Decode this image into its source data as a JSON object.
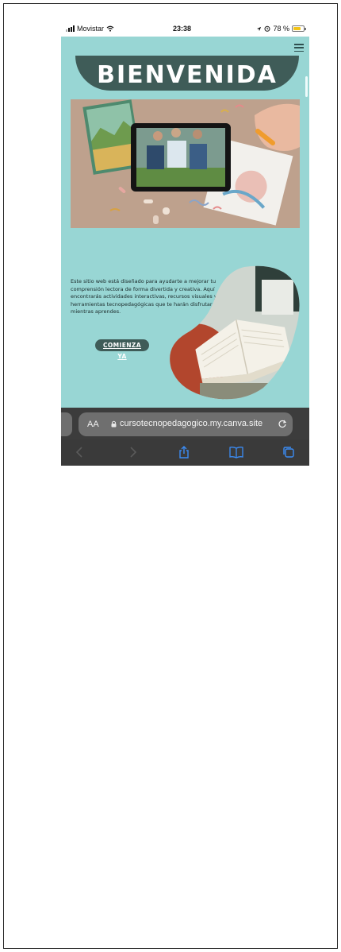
{
  "status_bar": {
    "carrier": "Movistar",
    "time": "23:38",
    "battery_percent": "78 %",
    "battery_level": 0.78
  },
  "site": {
    "banner_title": "BIENVENIDA",
    "intro_text": "Este sitio web está diseñado para ayudarte a mejorar tu comprensión lectora de forma divertida y creativa. Aquí encontrarás actividades interactivas, recursos visuales y herramientas tecnopedagógicas que te harán disfrutar mientras aprendes.",
    "cta_line1": "COMIENZA",
    "cta_line2": "YA"
  },
  "browser": {
    "aa_label": "AA",
    "url": "cursotecnopedagogico.my.canva.site"
  },
  "colors": {
    "page_bg": "#98d6d4",
    "accent_dark": "#3f5c58",
    "browser_bar": "#3c3c3c",
    "toolbar_icon": "#3b8cf5"
  },
  "icons": [
    "wifi-icon",
    "location-icon",
    "alarm-icon",
    "battery-icon",
    "menu-icon",
    "lock-icon",
    "reload-icon",
    "back-icon",
    "forward-icon",
    "share-icon",
    "bookmarks-icon",
    "tabs-icon"
  ]
}
